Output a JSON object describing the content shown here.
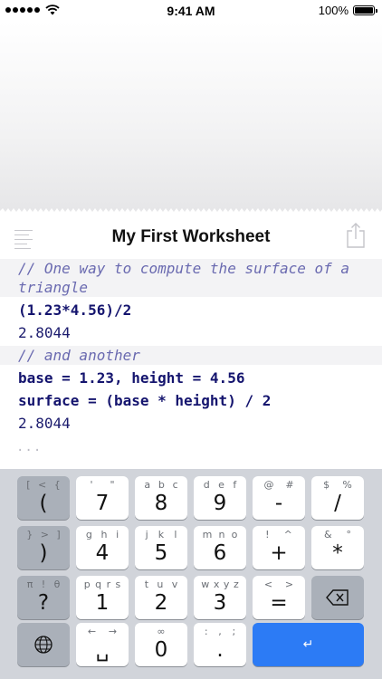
{
  "status_bar": {
    "time": "9:41 AM",
    "battery": "100%"
  },
  "header": {
    "title": "My First Worksheet"
  },
  "worksheet": {
    "lines": [
      {
        "kind": "comment",
        "text": "// One way to compute the surface of a triangle"
      },
      {
        "kind": "code",
        "text": "(1.23*4.56)/2"
      },
      {
        "kind": "result",
        "text": "2.8044"
      },
      {
        "kind": "comment",
        "text": "// and another"
      },
      {
        "kind": "code",
        "text": "base = 1.23, height = 4.56"
      },
      {
        "kind": "code",
        "text": "surface = (base * height) / 2"
      },
      {
        "kind": "result",
        "text": "2.8044"
      }
    ],
    "continuation": "..."
  },
  "keyboard": {
    "row1": [
      {
        "sub": [
          "[",
          "<",
          "{"
        ],
        "main": "("
      },
      {
        "sub": [
          "'",
          "\""
        ],
        "main": "7"
      },
      {
        "sub": [
          "a",
          "b",
          "c"
        ],
        "main": "8"
      },
      {
        "sub": [
          "d",
          "e",
          "f"
        ],
        "main": "9"
      },
      {
        "sub": [
          "@",
          "#"
        ],
        "main": "-"
      },
      {
        "sub": [
          "$",
          "%"
        ],
        "main": "/"
      }
    ],
    "row2": [
      {
        "sub": [
          "}",
          ">",
          "]"
        ],
        "main": ")"
      },
      {
        "sub": [
          "g",
          "h",
          "i"
        ],
        "main": "4"
      },
      {
        "sub": [
          "j",
          "k",
          "l"
        ],
        "main": "5"
      },
      {
        "sub": [
          "m",
          "n",
          "o"
        ],
        "main": "6"
      },
      {
        "sub": [
          "!",
          "^"
        ],
        "main": "+"
      },
      {
        "sub": [
          "&",
          "°"
        ],
        "main": "*"
      }
    ],
    "row3": [
      {
        "sub": [
          "π",
          "!",
          "θ"
        ],
        "main": "?"
      },
      {
        "sub": [
          "p",
          "q",
          "r",
          "s"
        ],
        "main": "1"
      },
      {
        "sub": [
          "t",
          "u",
          "v"
        ],
        "main": "2"
      },
      {
        "sub": [
          "w",
          "x",
          "y",
          "z"
        ],
        "main": "3"
      },
      {
        "sub": [
          "<",
          ">"
        ],
        "main": "="
      },
      {
        "icon": "backspace-icon"
      }
    ],
    "row4": [
      {
        "icon": "globe-icon"
      },
      {
        "sub": [
          "←",
          "→"
        ],
        "main": "␣"
      },
      {
        "sub": [
          "∞"
        ],
        "main": "0"
      },
      {
        "sub": [
          ":",
          ",",
          ";"
        ],
        "main": "."
      },
      {
        "main": "↵",
        "wide": true
      }
    ]
  }
}
